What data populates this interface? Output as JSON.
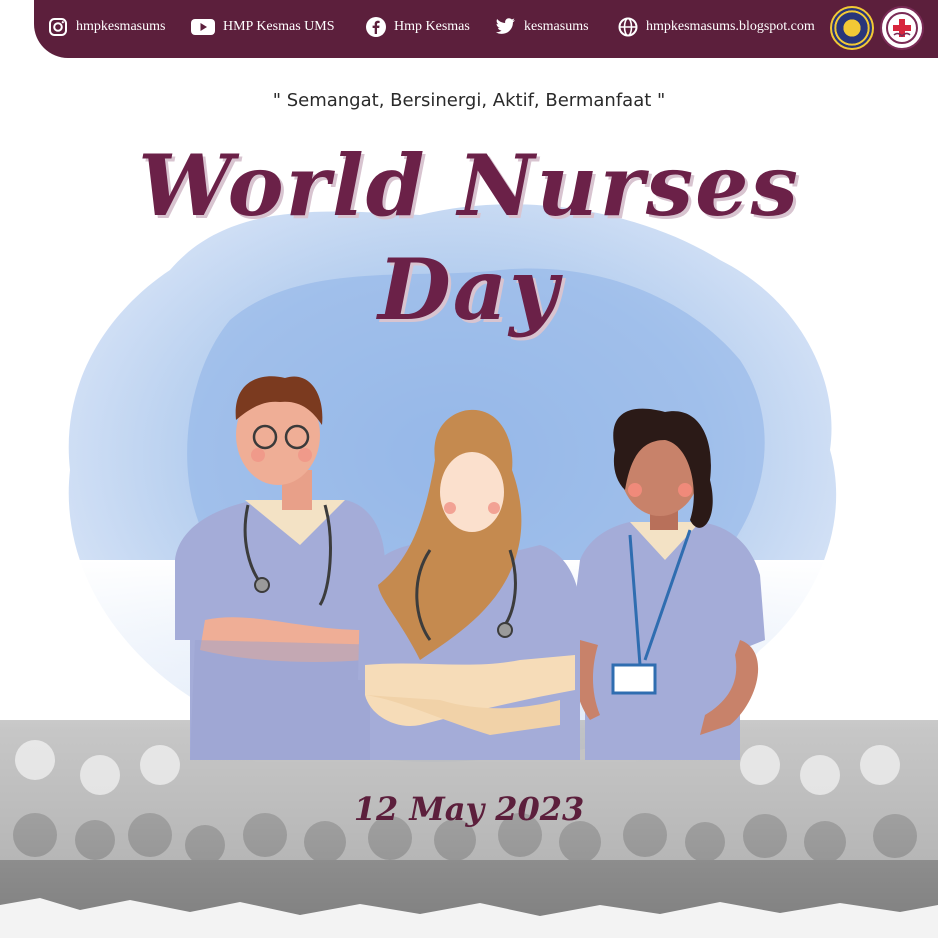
{
  "header": {
    "instagram": "hmpkesmasums",
    "youtube": "HMP Kesmas UMS",
    "facebook": "Hmp Kesmas",
    "twitter": "kesmasums",
    "website": "hmpkesmasums.blogspot.com"
  },
  "tagline": "\" Semangat, Bersinergi, Aktif, Bermanfaat \"",
  "title": {
    "line1": "World Nurses",
    "line2": "Day"
  },
  "date": "12 May 2023",
  "colors": {
    "brand": "#5c1f3c",
    "title": "#6b2148",
    "watercolor": "#a9c6ec",
    "scrubs": "#a4acd8"
  }
}
